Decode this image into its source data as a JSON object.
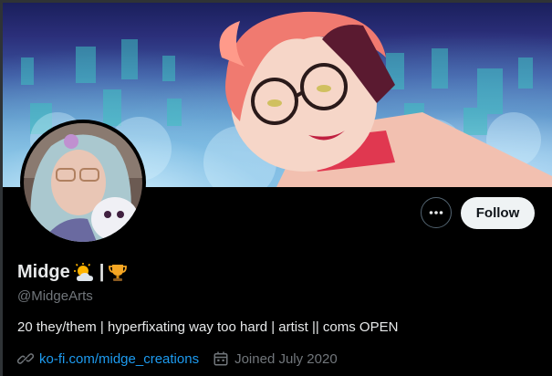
{
  "profile": {
    "display_name": "Midge",
    "name_emojis": [
      "sun-behind-cloud",
      "separator",
      "trophy"
    ],
    "separator_text": "|",
    "handle": "@MidgeArts",
    "bio": "20 they/them | hyperfixating way too hard | artist || coms OPEN",
    "website": "ko-fi.com/midge_creations",
    "joined": "Joined July 2020"
  },
  "actions": {
    "follow_label": "Follow",
    "more_icon": "more-dots-icon"
  },
  "icons": {
    "link": "link-icon",
    "calendar": "calendar-icon"
  },
  "colors": {
    "background": "#000000",
    "follow_bg": "#eff3f4",
    "link": "#1d9bf0",
    "secondary_text": "#71767b",
    "primary_text": "#e7e9ea"
  }
}
